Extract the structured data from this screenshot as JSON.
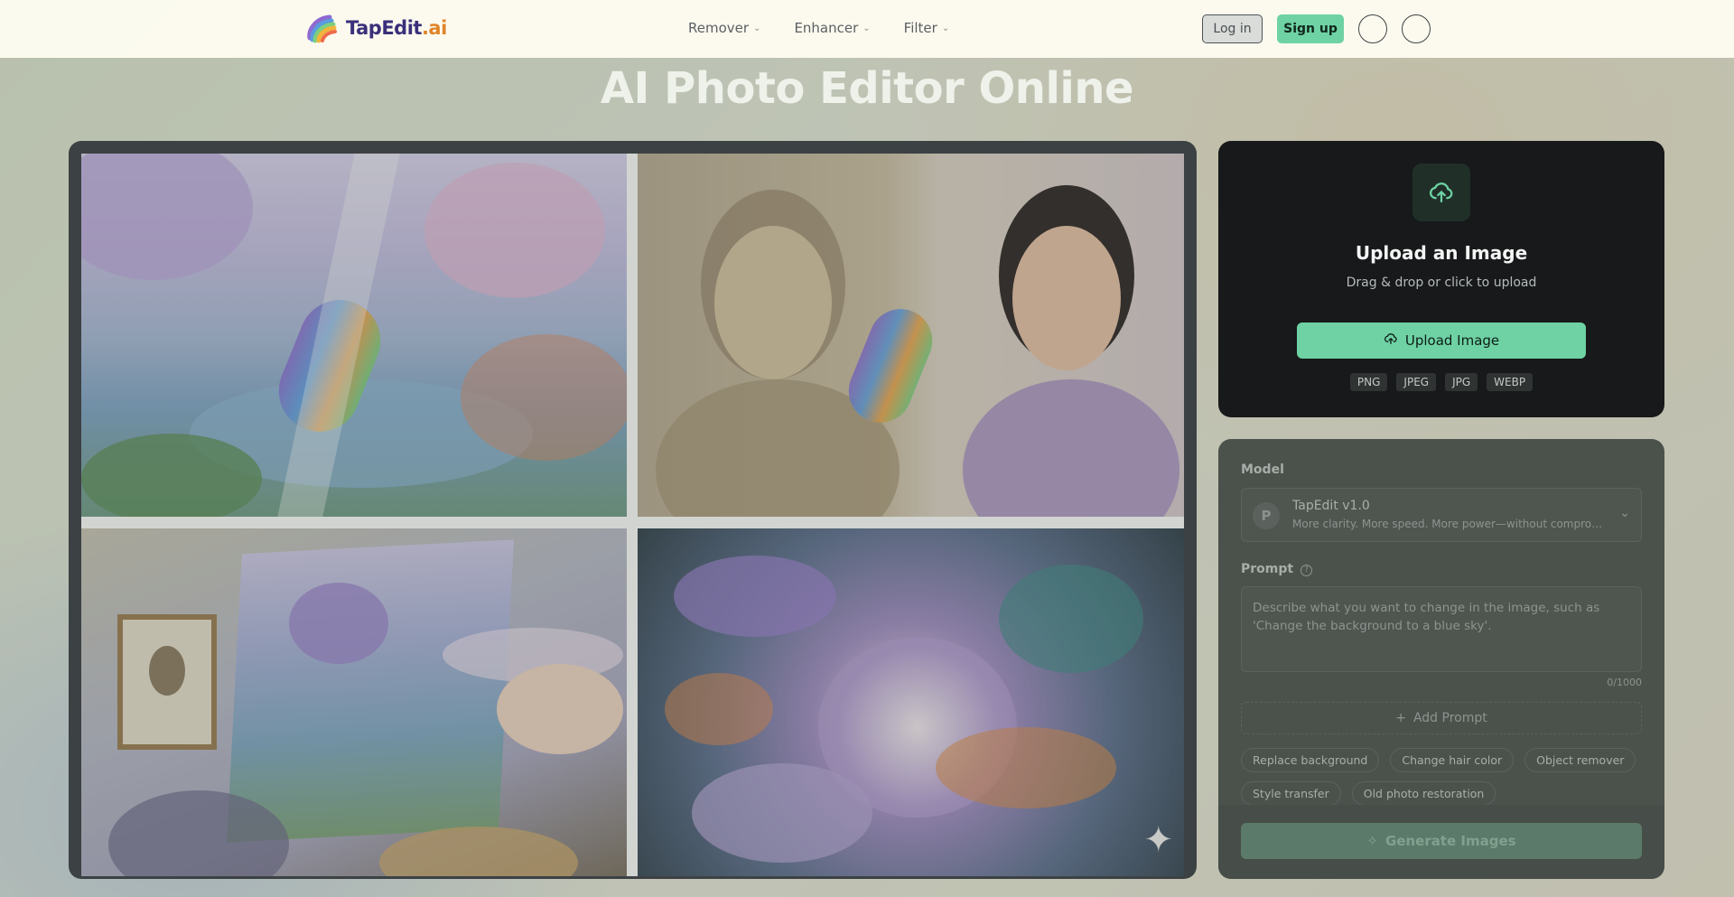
{
  "brand": {
    "name_part1": "TapEdit",
    "name_part2": ".ai"
  },
  "nav": [
    {
      "label": "Remover"
    },
    {
      "label": "Enhancer"
    },
    {
      "label": "Filter"
    }
  ],
  "auth": {
    "login": "Log in",
    "signup": "Sign up"
  },
  "page": {
    "title": "AI Photo Editor Online"
  },
  "upload": {
    "title": "Upload an Image",
    "subtitle": "Drag & drop or click to upload",
    "button": "Upload Image",
    "formats": [
      "PNG",
      "JPEG",
      "JPG",
      "WEBP"
    ]
  },
  "form": {
    "model_label": "Model",
    "model": {
      "avatar": "P",
      "name": "TapEdit v1.0",
      "description": "More clarity. More speed. More power—without compromise."
    },
    "prompt_label": "Prompt",
    "prompt_placeholder": "Describe what you want to change in the image, such as 'Change the background to a blue sky'.",
    "prompt_count": "0/1000",
    "add_prompt": "Add Prompt",
    "suggestions": [
      "Replace background",
      "Change hair color",
      "Object remover",
      "Style transfer",
      "Old photo restoration"
    ],
    "generate": "Generate Images"
  },
  "colors": {
    "accent": "#6ed2a4",
    "dark_card": "#17191a"
  }
}
